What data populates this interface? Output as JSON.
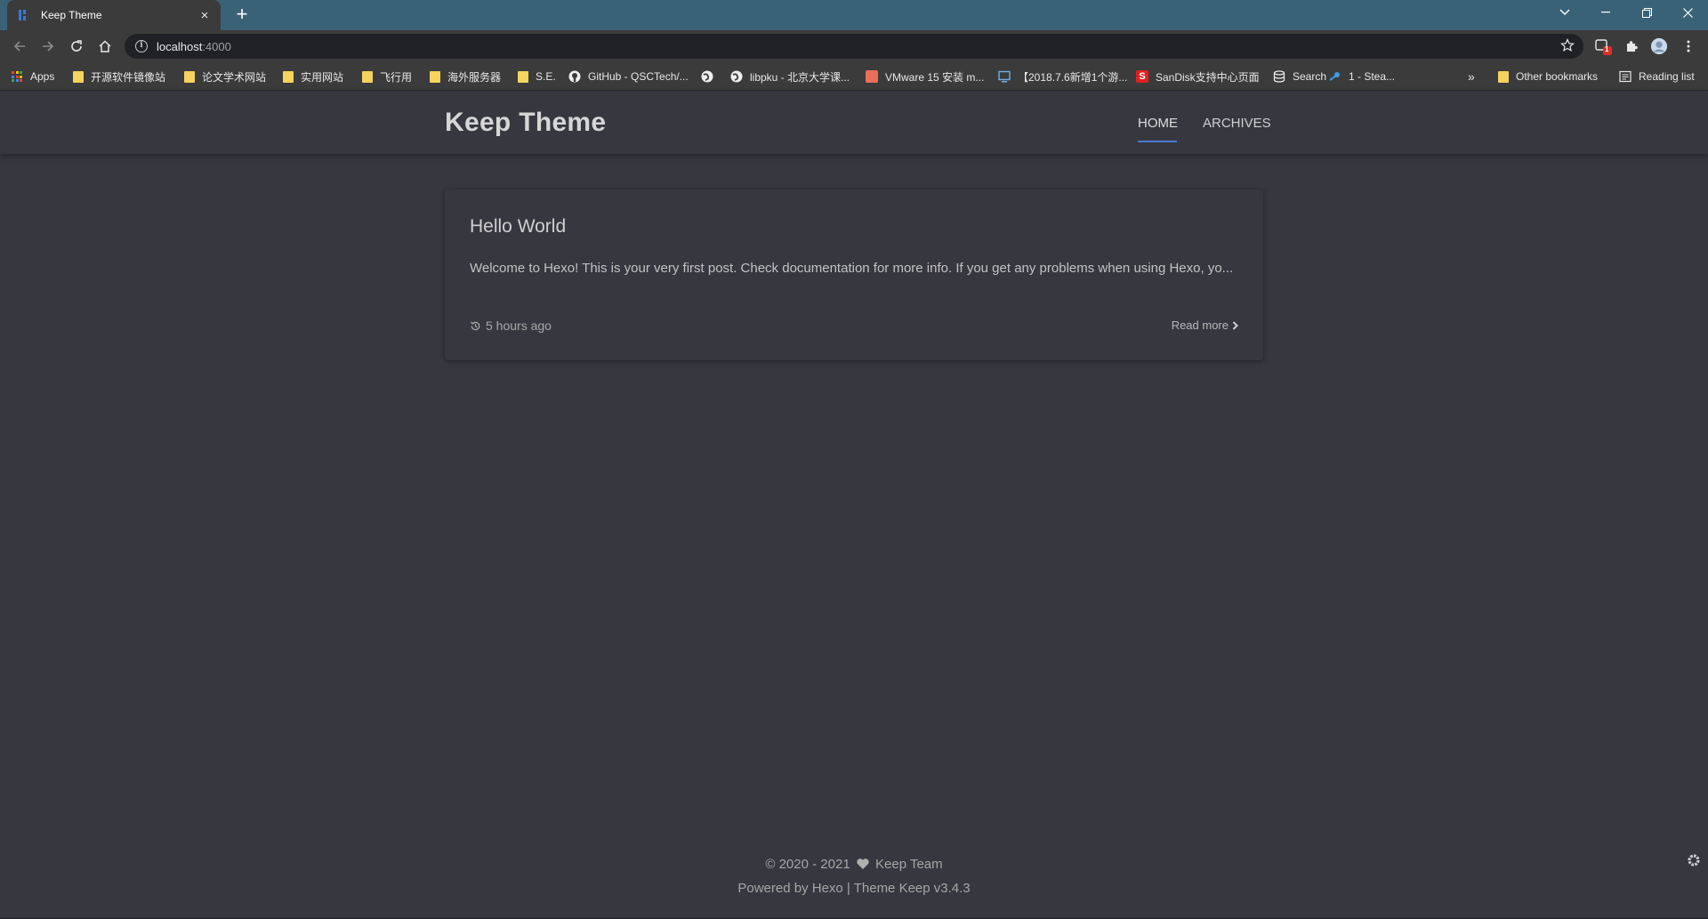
{
  "browser": {
    "tab": {
      "title": "Keep Theme",
      "close": "×"
    },
    "new_tab": "+",
    "window_controls": {
      "tabs_menu": "⌄",
      "minimize": "–",
      "restore": "❐",
      "close": "✕"
    },
    "omnibox": {
      "host": "localhost",
      "port": ":4000"
    },
    "extension_badge": "1"
  },
  "bookmarks": [
    {
      "label": "Apps",
      "icon": "apps-grid-icon"
    },
    {
      "label": "开源软件镜像站",
      "icon": "folder-icon"
    },
    {
      "label": "论文学术网站",
      "icon": "folder-icon"
    },
    {
      "label": "实用网站",
      "icon": "folder-icon"
    },
    {
      "label": "飞行用",
      "icon": "folder-icon"
    },
    {
      "label": "海外服务器",
      "icon": "folder-icon"
    },
    {
      "label": "S.E.",
      "icon": "folder-icon"
    },
    {
      "label": "GitHub - QSCTech/...",
      "icon": "github-icon"
    },
    {
      "label": "",
      "icon": "globe-icon"
    },
    {
      "label": "libpku - 北京大学课...",
      "icon": "globe-icon"
    },
    {
      "label": "VMware 15 安装 m...",
      "icon": "jianshu-icon"
    },
    {
      "label": "【2018.7.6新增1个游...",
      "icon": "monitor-icon"
    },
    {
      "label": "SanDisk支持中心页面",
      "icon": "sandisk-icon"
    },
    {
      "label": "Search",
      "icon": "database-icon"
    },
    {
      "label": "1 - Stea...",
      "icon": "steam-icon"
    },
    {
      "label": "»",
      "icon": ""
    },
    {
      "label": "Other bookmarks",
      "icon": "folder-icon"
    },
    {
      "label": "Reading list",
      "icon": "reading-list-icon"
    }
  ],
  "site": {
    "title": "Keep Theme",
    "menu": [
      {
        "label": "HOME",
        "active": true
      },
      {
        "label": "ARCHIVES",
        "active": false
      }
    ]
  },
  "post": {
    "title": "Hello World",
    "excerpt": "Welcome to Hexo! This is your very first post. Check documentation for more info. If you get any problems when using Hexo, yo...",
    "time": "5 hours ago",
    "read_more": "Read more"
  },
  "footer": {
    "copyright_prefix": "© 2020 - 2021",
    "team": "Keep Team",
    "powered": "Powered by Hexo | Theme Keep v3.4.3"
  },
  "colors": {
    "page_bg": "#373740",
    "tabbar_bg": "#3a6277",
    "accent_underline": "#4a7bd0"
  }
}
